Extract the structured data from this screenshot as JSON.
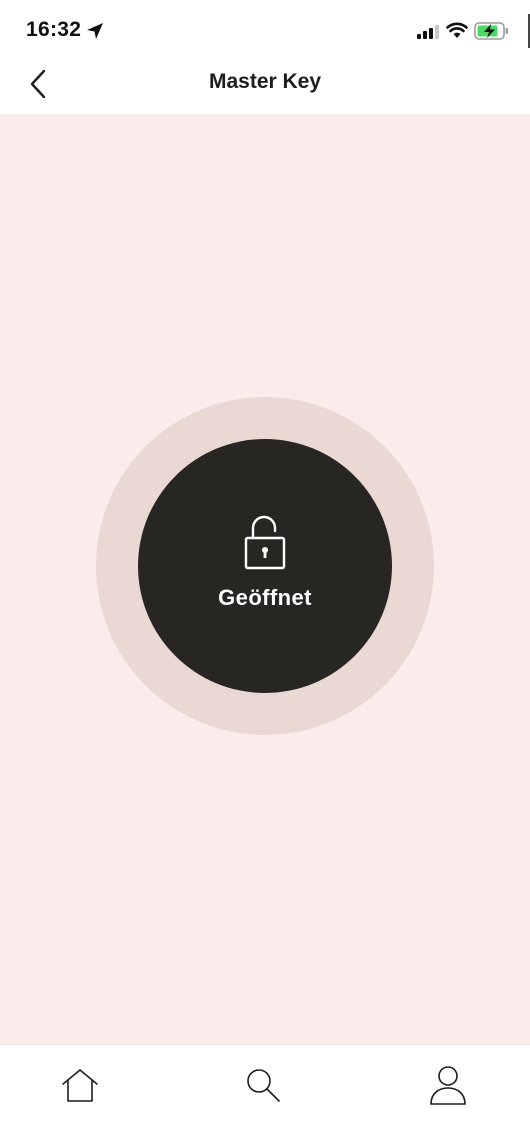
{
  "status_bar": {
    "time": "16:32",
    "icons": [
      "location-arrow-icon",
      "signal-icon",
      "wifi-icon",
      "battery-charging-icon"
    ],
    "battery_color": "#4cd964"
  },
  "nav": {
    "title": "Master Key",
    "back_icon": "chevron-left-icon"
  },
  "lock": {
    "status_label": "Geöffnet",
    "icon": "lock-open-icon",
    "colors": {
      "background": "#f9ecea",
      "outer_ring": "#ead8d2",
      "button": "#272623",
      "text": "#ffffff"
    }
  },
  "tab_bar": {
    "tabs": [
      {
        "icon": "home-icon"
      },
      {
        "icon": "search-icon"
      },
      {
        "icon": "profile-icon"
      }
    ]
  }
}
